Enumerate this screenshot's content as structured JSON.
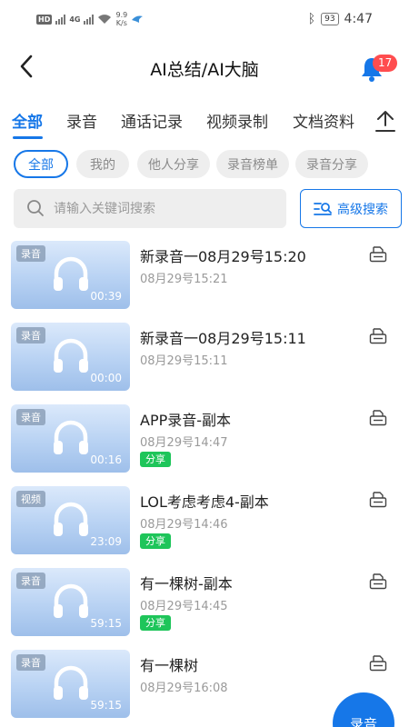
{
  "status_bar": {
    "hd_label": "HD",
    "network": "4G",
    "speed_value": "9.9",
    "speed_unit": "K/s",
    "battery": "93",
    "time": "4:47"
  },
  "header": {
    "title": "AI总结/AI大脑",
    "notification_count": "17"
  },
  "tabs": [
    {
      "label": "全部",
      "active": true
    },
    {
      "label": "录音",
      "active": false
    },
    {
      "label": "通话记录",
      "active": false
    },
    {
      "label": "视频录制",
      "active": false
    },
    {
      "label": "文档资料",
      "active": false
    }
  ],
  "filters": [
    {
      "label": "全部",
      "active": true
    },
    {
      "label": "我的",
      "active": false
    },
    {
      "label": "他人分享",
      "active": false
    },
    {
      "label": "录音榜单",
      "active": false
    },
    {
      "label": "录音分享",
      "active": false
    }
  ],
  "search": {
    "placeholder": "请输入关键词搜索",
    "advanced_label": "高级搜索"
  },
  "items": [
    {
      "tag": "录音",
      "duration": "00:39",
      "title": "新录音一08月29号15:20",
      "date": "08月29号15:21",
      "badge": ""
    },
    {
      "tag": "录音",
      "duration": "00:00",
      "title": "新录音一08月29号15:11",
      "date": "08月29号15:11",
      "badge": ""
    },
    {
      "tag": "录音",
      "duration": "00:16",
      "title": "APP录音-副本",
      "date": "08月29号14:47",
      "badge": "分享"
    },
    {
      "tag": "视频",
      "duration": "23:09",
      "title": "LOL考虑考虑4-副本",
      "date": "08月29号14:46",
      "badge": "分享"
    },
    {
      "tag": "录音",
      "duration": "59:15",
      "title": "有一棵树-副本",
      "date": "08月29号14:45",
      "badge": "分享"
    },
    {
      "tag": "录音",
      "duration": "59:15",
      "title": "有一棵树",
      "date": "08月29号16:08",
      "badge": ""
    }
  ],
  "fab": {
    "label": "录音"
  },
  "colors": {
    "accent": "#1677e8",
    "badge_red": "#ff4d4f",
    "share_green": "#1ec55a",
    "chip_bg": "#eeeeee"
  },
  "icons": {
    "back": "chevron-left-icon",
    "bell": "bell-icon",
    "upload": "upload-icon",
    "search": "search-icon",
    "advanced_search": "filter-search-icon",
    "thumbnail": "headphone-icon",
    "item_action": "document-icon"
  }
}
